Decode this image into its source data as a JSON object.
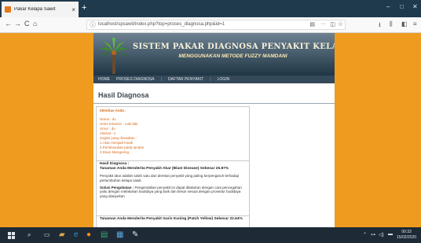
{
  "browser": {
    "tab_title": "Pakar Kelapa Sawit",
    "tab_close": "×",
    "new_tab": "+",
    "nav": {
      "back": "←",
      "forward": "→",
      "reload": "C",
      "home": "⌂"
    },
    "url": "localhost/spsawit/index.php?top=proses_diagnosa.php&id=1",
    "window_controls": {
      "minimize": "–",
      "maximize": "□",
      "close": "✕"
    }
  },
  "site": {
    "title": "SISTEM PAKAR DIAGNOSA PENYAKIT KELAPA SAWIT",
    "subtitle": "MENGGUNAKAN METODE FUZZY MAMDANI",
    "menu": [
      "HOME",
      "PROSES DIAGNOSA",
      "DAFTAR PENYAKIT",
      "LOGIN"
    ],
    "heading": "Hasil Diagnosa"
  },
  "identitas": {
    "heading": "Identitas Anda :",
    "lines": [
      "Nama : do",
      "Jenis Kelamin : Laki-laki",
      "Umur : do",
      "Alamat : s",
      "Gejala yang dirasakan :",
      "1.Akar menjadi lunak",
      "2.Pembusukan pada tandan",
      "3.Daun Mengering"
    ]
  },
  "result1": {
    "label": "Hasil Diagnosa :",
    "title": "Tanaman Anda Menderita Penyakit Akar (Blast Disease) Sebesar 25.87%",
    "description": "Penyakit akar adalah salah satu dari deretan penyakit yang paling berpengaruh terhadap pertumbuhan kelapa sawit.",
    "solution_label": "Solusi Pengobatan :",
    "solution": "Pengendalian penyakit ini dapat dilakukan dengan cara pencegahan yaitu dengan melakukan budidaya yang baik dan benar sesuai dengan prosedur budidaya yang dianjurkan"
  },
  "result2": {
    "title": "Tanaman Anda Menderita Penyakit Garis Kuning (Patch Yellow) Sebesar 22.64%"
  },
  "taskbar": {
    "clock_time": "00:33",
    "clock_date": "15/02/2020"
  },
  "colors": {
    "page_bg": "#ee9b1f",
    "banner_top": "#6d8191",
    "banner_bottom": "#1f3645",
    "menu_bg": "#34495a",
    "identitas_text": "#d76a1a"
  }
}
